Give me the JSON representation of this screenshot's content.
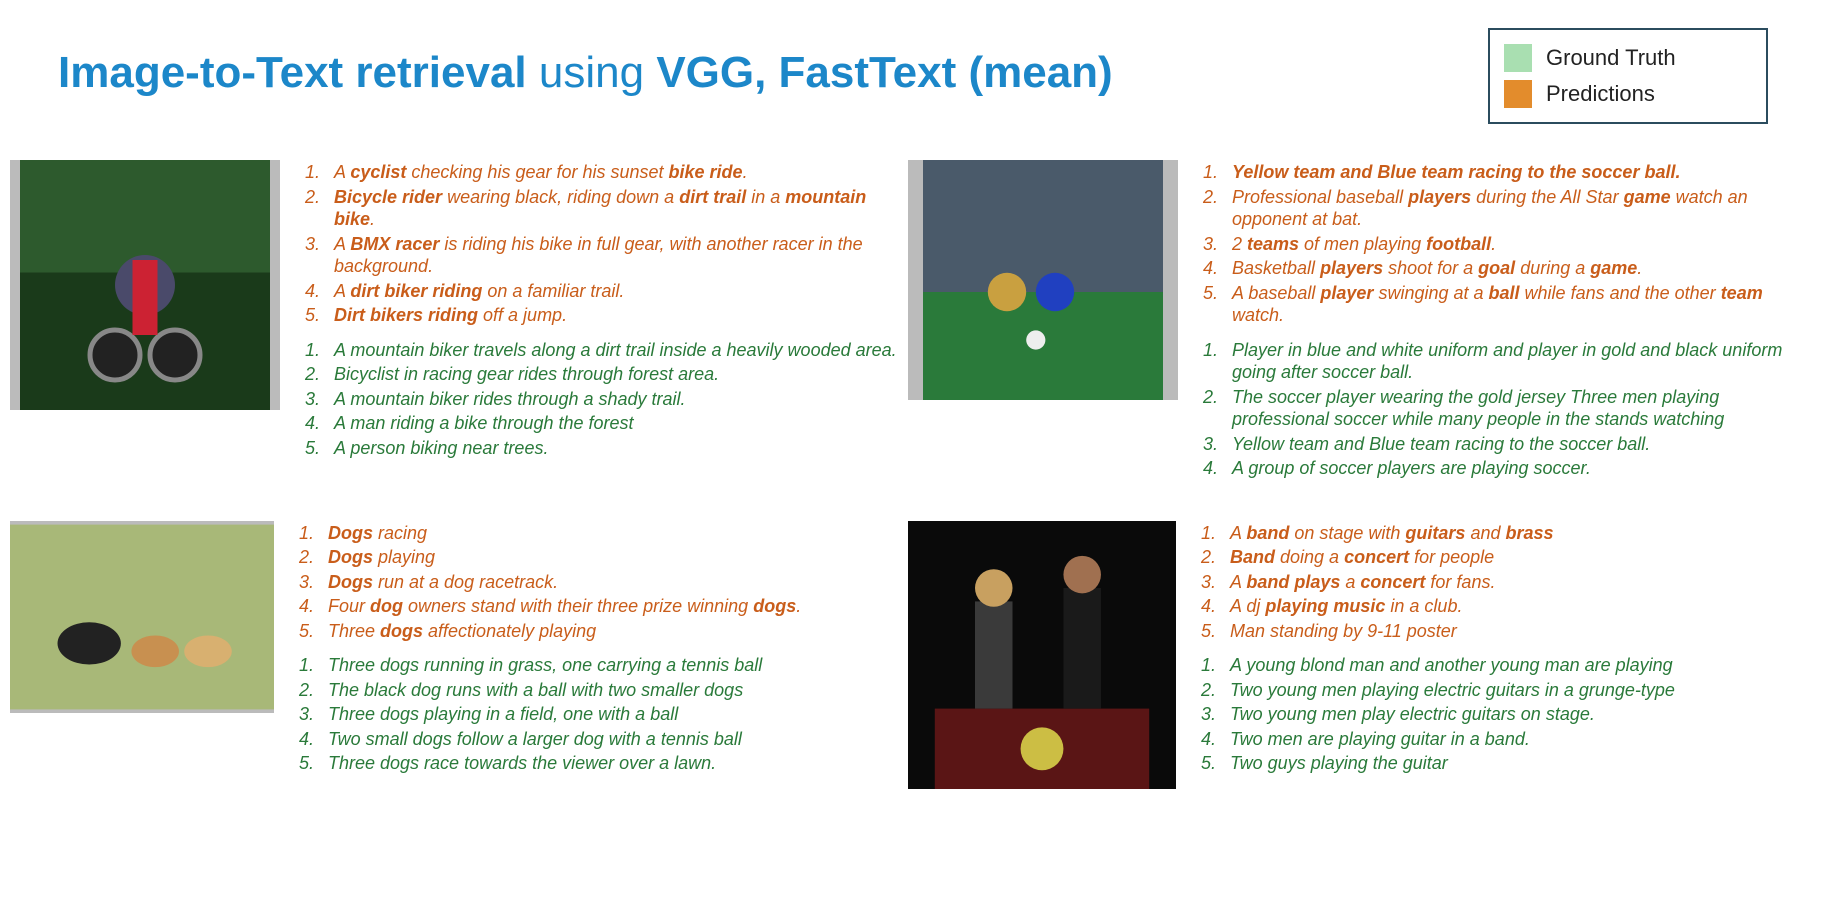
{
  "title_parts": {
    "bold1": "Image-to-Text retrieval",
    "plain1": " using ",
    "bold2": "VGG, FastText (mean)"
  },
  "legend": {
    "gt": "Ground Truth",
    "pred": "Predictions"
  },
  "panels": [
    {
      "image_alt": "cyclist on forest trail",
      "thumb_w": 270,
      "thumb_h": 250,
      "predictions": [
        [
          [
            "A "
          ],
          [
            "b",
            "cyclist"
          ],
          [
            " checking his gear for his sunset "
          ],
          [
            "b",
            "bike ride"
          ],
          [
            "."
          ]
        ],
        [
          [
            "b",
            "Bicycle rider"
          ],
          [
            " wearing black, riding down a "
          ],
          [
            "b",
            "dirt trail"
          ],
          [
            " in a "
          ],
          [
            "b",
            "mountain bike"
          ],
          [
            "."
          ]
        ],
        [
          [
            "A "
          ],
          [
            "b",
            "BMX racer"
          ],
          [
            " is riding his bike in full gear, with another racer in the background."
          ]
        ],
        [
          [
            "A "
          ],
          [
            "b",
            "dirt biker riding"
          ],
          [
            " on a familiar trail."
          ]
        ],
        [
          [
            "b",
            "Dirt bikers riding"
          ],
          [
            " off a jump."
          ]
        ]
      ],
      "ground_truth": [
        "A mountain biker travels along a dirt trail inside a heavily wooded area.",
        "Bicyclist in racing gear rides through forest area.",
        "A mountain biker rides through a shady trail.",
        "A man riding a bike through the forest",
        "A person biking near trees."
      ]
    },
    {
      "image_alt": "soccer players competing for ball",
      "thumb_w": 270,
      "thumb_h": 240,
      "predictions": [
        [
          [
            "b",
            "Yellow team and Blue team racing to the soccer ball."
          ]
        ],
        [
          [
            "Professional baseball "
          ],
          [
            "b",
            "players"
          ],
          [
            " during the All Star "
          ],
          [
            "b",
            "game"
          ],
          [
            " watch an opponent at bat."
          ]
        ],
        [
          [
            "2 "
          ],
          [
            "b",
            "teams"
          ],
          [
            " of men playing "
          ],
          [
            "b",
            "football"
          ],
          [
            "."
          ]
        ],
        [
          [
            "Basketball "
          ],
          [
            "b",
            "players"
          ],
          [
            " shoot for a "
          ],
          [
            "b",
            "goal"
          ],
          [
            " during a "
          ],
          [
            "b",
            "game"
          ],
          [
            "."
          ]
        ],
        [
          [
            "A baseball "
          ],
          [
            "b",
            "player"
          ],
          [
            " swinging at a "
          ],
          [
            "b",
            "ball"
          ],
          [
            " while fans and the other "
          ],
          [
            "b",
            "team"
          ],
          [
            " watch."
          ]
        ]
      ],
      "ground_truth": [
        "Player in blue and white uniform and player in gold and black uniform going after soccer ball.",
        "The soccer player wearing the gold jersey Three men playing professional soccer while many people in the stands watching",
        "Yellow team and Blue team racing to the soccer ball.",
        "A group of soccer players are playing soccer."
      ]
    },
    {
      "image_alt": "three dogs running on grass",
      "thumb_w": 264,
      "thumb_h": 192,
      "predictions": [
        [
          [
            "b",
            "Dogs"
          ],
          [
            " racing"
          ]
        ],
        [
          [
            "b",
            "Dogs"
          ],
          [
            " playing"
          ]
        ],
        [
          [
            "b",
            "Dogs"
          ],
          [
            " run at a dog racetrack."
          ]
        ],
        [
          [
            "Four "
          ],
          [
            "b",
            "dog"
          ],
          [
            " owners stand with their three prize winning "
          ],
          [
            "b",
            "dogs"
          ],
          [
            "."
          ]
        ],
        [
          [
            "Three "
          ],
          [
            "b",
            "dogs"
          ],
          [
            " affectionately playing"
          ]
        ]
      ],
      "ground_truth": [
        "Three dogs running in grass, one carrying a tennis ball",
        "The black dog runs with a ball with two smaller dogs",
        "Three dogs playing in a field, one with a ball",
        "Two small dogs follow a larger dog with a tennis ball",
        "Three dogs race towards the viewer over a lawn."
      ]
    },
    {
      "image_alt": "two guitarists performing on stage",
      "thumb_w": 268,
      "thumb_h": 268,
      "predictions": [
        [
          [
            "A "
          ],
          [
            "b",
            "band"
          ],
          [
            " on stage with "
          ],
          [
            "b",
            "guitars"
          ],
          [
            " and "
          ],
          [
            "b",
            "brass"
          ]
        ],
        [
          [
            "b",
            "Band"
          ],
          [
            " doing a "
          ],
          [
            "b",
            "concert"
          ],
          [
            " for people"
          ]
        ],
        [
          [
            "A "
          ],
          [
            "b",
            "band plays"
          ],
          [
            " a "
          ],
          [
            "b",
            "concert"
          ],
          [
            " for fans."
          ]
        ],
        [
          [
            "A dj "
          ],
          [
            "b",
            "playing music"
          ],
          [
            " in a club."
          ]
        ],
        [
          [
            "Man standing by 9-11 poster"
          ]
        ]
      ],
      "ground_truth": [
        "A young blond man and another young man are playing",
        "Two young men playing electric guitars in a grunge-type",
        "Two young men play electric guitars on stage.",
        "Two men are playing guitar in a band.",
        "Two guys playing the guitar"
      ]
    }
  ]
}
